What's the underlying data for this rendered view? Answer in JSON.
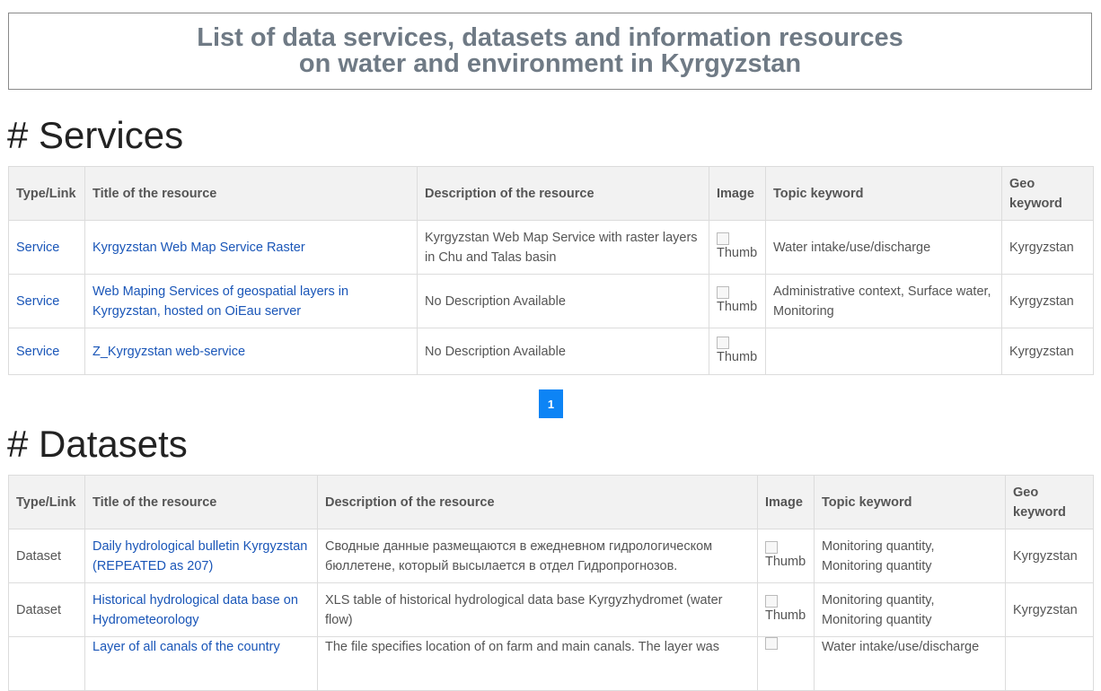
{
  "banner": {
    "line1": "List of data services, datasets and information resources",
    "line2": "on water and environment in Kyrgyzstan"
  },
  "services": {
    "heading": "# Services",
    "headers": [
      "Type/Link",
      "Title of the resource",
      "Description of the resource",
      "Image",
      "Topic keyword",
      "Geo keyword"
    ],
    "rows": [
      {
        "type": "Service",
        "title": "Kyrgyzstan Web Map Service Raster",
        "description": "Kyrgyzstan Web Map Service with raster layers in Chu and Talas basin",
        "image_alt": "Thumb",
        "topic": "Water intake/use/discharge",
        "geo": "Kyrgyzstan"
      },
      {
        "type": "Service",
        "title": "Web Maping Services of geospatial layers in Kyrgyzstan, hosted on OiEau server",
        "description": "No Description Available",
        "image_alt": "Thumb",
        "topic": "Administrative context, Surface water, Monitoring",
        "geo": "Kyrgyzstan"
      },
      {
        "type": "Service",
        "title": "Z_Kyrgyzstan web-service",
        "description": "No Description Available",
        "image_alt": "Thumb",
        "topic": "",
        "geo": "Kyrgyzstan"
      }
    ],
    "pagination": {
      "current_page": "1"
    }
  },
  "datasets": {
    "heading": "# Datasets",
    "headers": [
      "Type/Link",
      "Title of the resource",
      "Description of the resource",
      "Image",
      "Topic keyword",
      "Geo keyword"
    ],
    "rows": [
      {
        "type": "Dataset",
        "title": "Daily hydrological bulletin Kyrgyzstan (REPEATED as 207)",
        "description": "Сводные данные размещаются в ежедневном гидрологическом бюллетене, который высылается в отдел Гидропрогнозов.",
        "image_alt": "Thumb",
        "topic": "Monitoring quantity, Monitoring quantity",
        "geo": "Kyrgyzstan"
      },
      {
        "type": "Dataset",
        "title": "Historical hydrological data base on Hydrometeorology",
        "description": "XLS table of historical hydrological data base Kyrgyzhydromet (water flow)",
        "image_alt": "Thumb",
        "topic": "Monitoring quantity, Monitoring quantity",
        "geo": "Kyrgyzstan"
      },
      {
        "type": "",
        "title": "Layer of all canals of the country",
        "description": "The file specifies location of on farm and main canals. The layer was",
        "image_alt": "",
        "topic": "Water intake/use/discharge",
        "geo": ""
      }
    ]
  }
}
